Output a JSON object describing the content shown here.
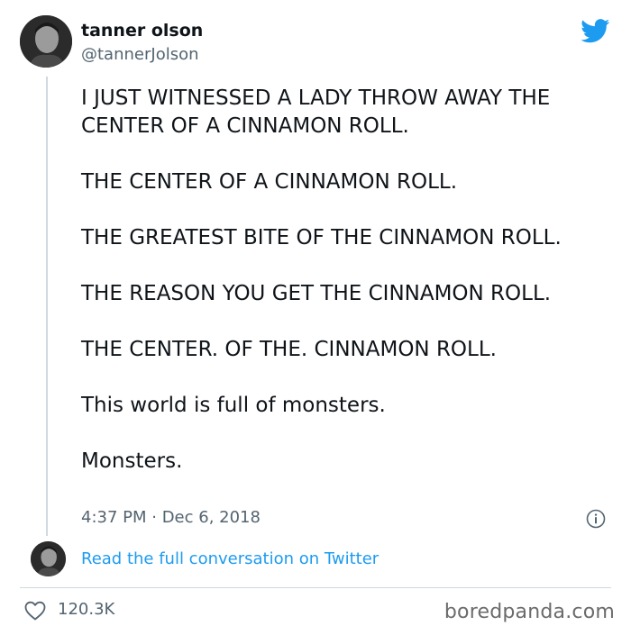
{
  "author": {
    "name": "tanner olson",
    "handle": "@tannerJolson"
  },
  "tweet": {
    "paragraphs": [
      "I JUST WITNESSED A LADY THROW AWAY THE CENTER OF A CINNAMON ROLL.",
      "THE CENTER OF A CINNAMON ROLL.",
      "THE GREATEST BITE OF THE CINNAMON ROLL.",
      "THE REASON YOU GET THE CINNAMON ROLL.",
      "THE CENTER. OF THE. CINNAMON ROLL.",
      "This world is full of monsters.",
      "Monsters."
    ],
    "timestamp": "4:37 PM · Dec 6, 2018"
  },
  "conversation": {
    "link_label": "Read the full conversation on Twitter"
  },
  "engagement": {
    "likes": "120.3K"
  },
  "watermark": "boredpanda.com",
  "icons": {
    "brand": "twitter-bird-icon",
    "info": "info-icon",
    "like": "heart-icon"
  },
  "colors": {
    "brand": "#1d9bf0",
    "text": "#0f1419",
    "muted": "#536471",
    "divider": "#cfd9de"
  }
}
